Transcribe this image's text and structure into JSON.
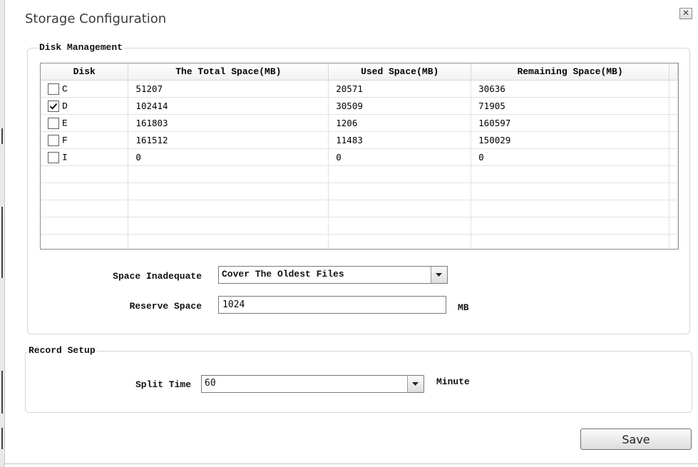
{
  "window": {
    "title": "Storage Configuration",
    "close_glyph": "✕"
  },
  "disk_management": {
    "legend": "Disk Management",
    "columns": [
      "Disk",
      "The Total Space(MB)",
      "Used Space(MB)",
      "Remaining Space(MB)"
    ],
    "rows": [
      {
        "disk": "C",
        "checked": false,
        "total": "51207",
        "used": "20571",
        "remaining": "30636"
      },
      {
        "disk": "D",
        "checked": true,
        "total": "102414",
        "used": "30509",
        "remaining": "71905"
      },
      {
        "disk": "E",
        "checked": false,
        "total": "161803",
        "used": "1206",
        "remaining": "160597"
      },
      {
        "disk": "F",
        "checked": false,
        "total": "161512",
        "used": "11483",
        "remaining": "150029"
      },
      {
        "disk": "I",
        "checked": false,
        "total": "0",
        "used": "0",
        "remaining": "0"
      }
    ],
    "empty_rows": 5,
    "space_inadequate": {
      "label": "Space Inadequate",
      "value": "Cover The Oldest Files"
    },
    "reserve_space": {
      "label": "Reserve Space",
      "value": "1024",
      "unit": "MB"
    }
  },
  "record_setup": {
    "legend": "Record Setup",
    "split_time": {
      "label": "Split Time",
      "value": "60",
      "unit": "Minute"
    }
  },
  "actions": {
    "save_label": "Save"
  },
  "icons": {
    "close": "close-icon",
    "checkbox_check": "check-icon",
    "dropdown": "chevron-down-icon"
  }
}
